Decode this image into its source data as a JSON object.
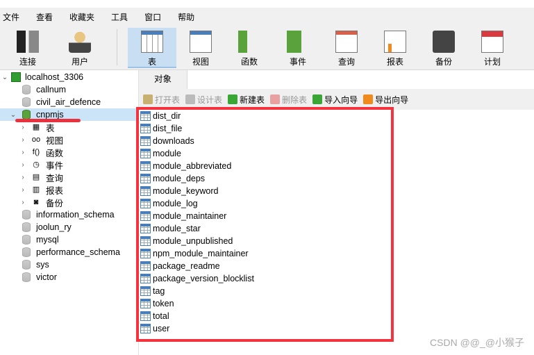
{
  "menu": [
    "文件",
    "查看",
    "收藏夹",
    "工具",
    "窗口",
    "帮助"
  ],
  "toolbar": [
    {
      "label": "连接",
      "icon": "connection-icon"
    },
    {
      "label": "用户",
      "icon": "user-icon"
    },
    {
      "label": "表",
      "icon": "table-icon",
      "active": true
    },
    {
      "label": "视图",
      "icon": "view-icon"
    },
    {
      "label": "函数",
      "icon": "function-icon"
    },
    {
      "label": "事件",
      "icon": "event-icon"
    },
    {
      "label": "查询",
      "icon": "query-icon"
    },
    {
      "label": "报表",
      "icon": "report-icon"
    },
    {
      "label": "备份",
      "icon": "backup-icon"
    },
    {
      "label": "计划",
      "icon": "schedule-icon"
    }
  ],
  "sidebar": {
    "connection": "localhost_3306",
    "databases_before": [
      "callnum",
      "civil_air_defence"
    ],
    "selected": "cnpmjs",
    "children": [
      {
        "label": "表",
        "icon": "table-icon"
      },
      {
        "label": "视图",
        "icon": "view-icon"
      },
      {
        "label": "函数",
        "icon": "function-icon"
      },
      {
        "label": "事件",
        "icon": "event-icon"
      },
      {
        "label": "查询",
        "icon": "query-icon"
      },
      {
        "label": "报表",
        "icon": "report-icon"
      },
      {
        "label": "备份",
        "icon": "backup-icon"
      }
    ],
    "databases_after": [
      "information_schema",
      "joolun_ry",
      "mysql",
      "performance_schema",
      "sys",
      "victor"
    ]
  },
  "object_tab": "对象",
  "object_toolbar": [
    {
      "label": "打开表",
      "disabled": true,
      "color": "#c8b070"
    },
    {
      "label": "设计表",
      "disabled": true,
      "color": "#bbbbbb"
    },
    {
      "label": "新建表",
      "disabled": false,
      "color": "#3aa635"
    },
    {
      "label": "删除表",
      "disabled": true,
      "color": "#e8a0a0"
    },
    {
      "label": "导入向导",
      "disabled": false,
      "color": "#3aa635"
    },
    {
      "label": "导出向导",
      "disabled": false,
      "color": "#f08a1c"
    }
  ],
  "tables": [
    "dist_dir",
    "dist_file",
    "downloads",
    "module",
    "module_abbreviated",
    "module_deps",
    "module_keyword",
    "module_log",
    "module_maintainer",
    "module_star",
    "module_unpublished",
    "npm_module_maintainer",
    "package_readme",
    "package_version_blocklist",
    "tag",
    "token",
    "total",
    "user"
  ],
  "watermark": "CSDN @@_@小猴子",
  "colors": {
    "highlight": "#f5333f",
    "selection": "#cce4f7",
    "active_tool": "#c8dff3"
  }
}
